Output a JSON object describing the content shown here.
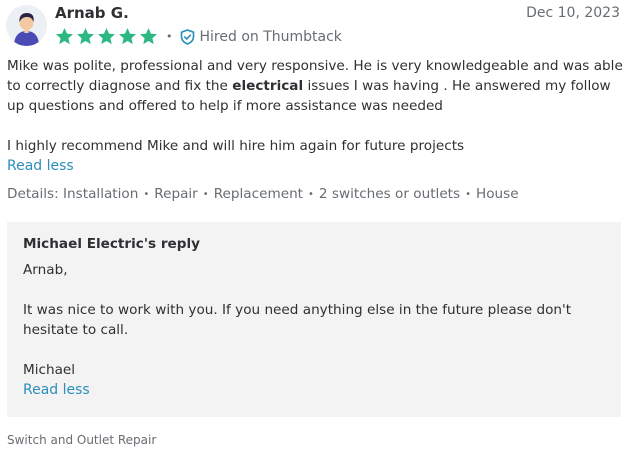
{
  "reviewer": {
    "name": "Arnab G.",
    "date": "Dec 10, 2023",
    "rating": 5,
    "hired_label": "Hired on Thumbtack"
  },
  "review": {
    "line1_pre": "Mike was polite, professional and very responsive. He is very knowledgeable and was able to correctly diagnose and fix the ",
    "highlight": "electrical",
    "line1_post": " issues I was having . He answered my follow up questions and offered to help if more assistance was needed",
    "paragraph2": "I highly recommend Mike and will hire him again for future projects",
    "read_less": "Read less"
  },
  "details": {
    "label": "Details:",
    "items": [
      "Installation",
      "Repair",
      "Replacement",
      "2 switches or outlets",
      "House"
    ]
  },
  "reply": {
    "title": "Michael Electric's reply",
    "greeting": "Arnab,",
    "message": "It was nice to work with you. If you need anything else in the future please don't hesitate to call.",
    "signature": "Michael",
    "read_less": "Read less"
  },
  "service": "Switch and Outlet Repair",
  "colors": {
    "star": "#2db783",
    "link": "#2b8ebd",
    "muted": "#676d73",
    "reply_bg": "#f3f3f3"
  },
  "icons": {
    "avatar": "person-avatar-icon",
    "star": "star-icon",
    "hired": "shield-check-icon"
  }
}
